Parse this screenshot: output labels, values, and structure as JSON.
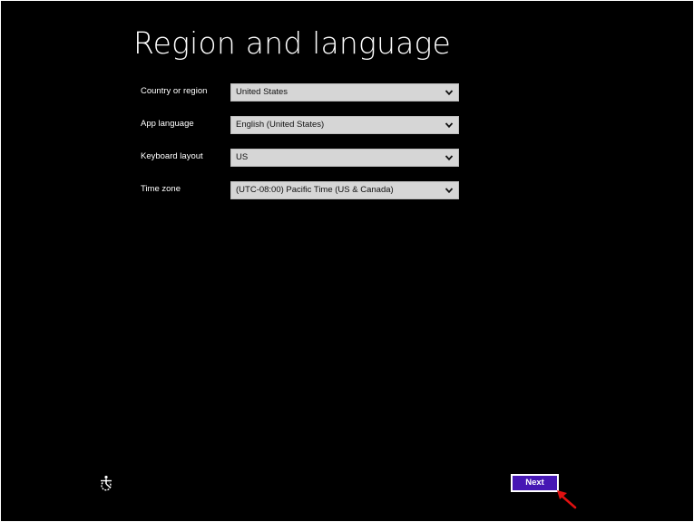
{
  "page": {
    "title": "Region and language"
  },
  "fields": [
    {
      "label": "Country or region",
      "value": "United States"
    },
    {
      "label": "App language",
      "value": "English (United States)"
    },
    {
      "label": "Keyboard layout",
      "value": "US"
    },
    {
      "label": "Time zone",
      "value": "(UTC-08:00) Pacific Time (US & Canada)"
    }
  ],
  "footer": {
    "next_label": "Next"
  },
  "icons": {
    "accessibility": "ease-of-access-icon",
    "dropdown": "chevron-down-icon",
    "pointer": "red-arrow-cursor-icon"
  },
  "colors": {
    "background": "#000000",
    "next_button": "#4617b4",
    "select_background": "#d6d6d6",
    "cursor": "#e01010"
  }
}
